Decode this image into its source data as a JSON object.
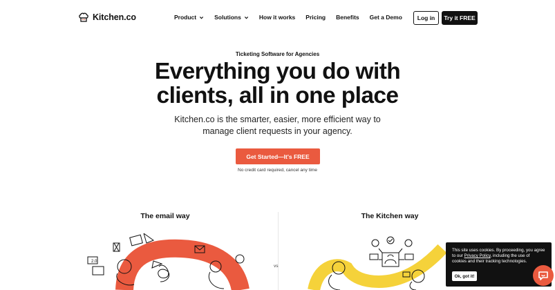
{
  "header": {
    "logo_text": "Kitchen.co",
    "nav": [
      {
        "label": "Product",
        "has_dropdown": true
      },
      {
        "label": "Solutions",
        "has_dropdown": true
      },
      {
        "label": "How it works",
        "has_dropdown": false
      },
      {
        "label": "Pricing",
        "has_dropdown": false
      },
      {
        "label": "Benefits",
        "has_dropdown": false
      },
      {
        "label": "Get a Demo",
        "has_dropdown": false
      }
    ],
    "login_label": "Log in",
    "try_label": "Try it FREE"
  },
  "hero": {
    "eyebrow": "Ticketing Software for Agencies",
    "headline_line1": "Everything you do with",
    "headline_line2": "clients, all in one place",
    "sub_line1": "Kitchen.co is the smarter, easier, more efficient way to",
    "sub_line2": "manage client requests in your agency.",
    "cta_label": "Get Started—It's FREE",
    "note": "No credit card required, cancel any time"
  },
  "comparison": {
    "left_title": "The email way",
    "right_title": "The Kitchen way",
    "vs_label": "vs"
  },
  "cookie": {
    "text_before": "This site uses cookies. By proceeding, you agree to our ",
    "link": "Privacy Policy",
    "text_after": ", including the use of cookies and their tracking technologies.",
    "button_label": "Ok, got it!"
  },
  "colors": {
    "accent": "#ea5a3f",
    "yellow": "#f5d23a",
    "ink": "#111111"
  },
  "icons": [
    "chef-hat-logo-icon",
    "chevron-down-icon",
    "chat-bubble-icon"
  ]
}
